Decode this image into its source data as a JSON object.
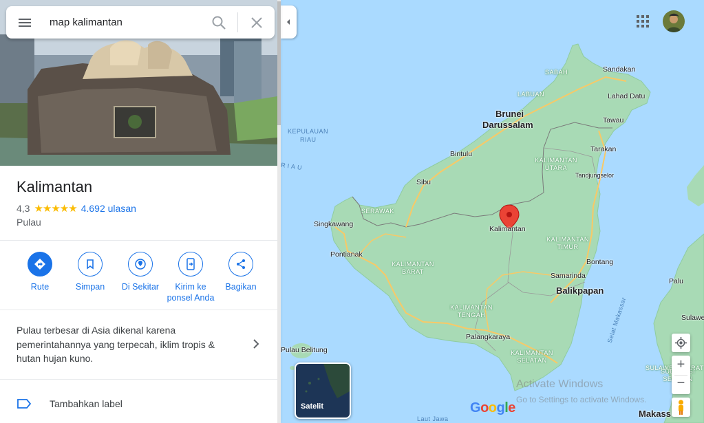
{
  "search": {
    "query": "map kalimantan",
    "menu_icon": "hamburger-menu-icon",
    "search_icon": "magnifier-icon",
    "clear_icon": "close-icon"
  },
  "place": {
    "title": "Kalimantan",
    "rating": "4,3",
    "stars": "★★★★★",
    "reviews": "4.692 ulasan",
    "type": "Pulau",
    "description": "Pulau terbesar di Asia dikenal karena pemerintahannya yang terpecah, iklim tropis & hutan hujan kuno."
  },
  "actions": [
    {
      "label": "Rute",
      "icon": "directions-icon"
    },
    {
      "label": "Simpan",
      "icon": "bookmark-icon"
    },
    {
      "label": "Di Sekitar",
      "icon": "nearby-icon"
    },
    {
      "label": "Kirim ke ponsel Anda",
      "icon": "send-to-phone-icon"
    },
    {
      "label": "Bagikan",
      "icon": "share-icon"
    }
  ],
  "label_row": {
    "text": "Tambahkan label",
    "icon": "label-icon"
  },
  "map": {
    "layer_button": "Satelit",
    "zoom_in": "+",
    "zoom_out": "−",
    "brand": "Google",
    "watermark_line1": "Activate Windows",
    "watermark_line2": "Go to Settings to activate Windows.",
    "pin_label": "Kalimantan",
    "regions": [
      "SABAH",
      "LABUAN",
      "SERAWAK",
      "KALIMANTAN UTARA",
      "KALIMANTAN TIMUR",
      "KALIMANTAN BARAT",
      "KALIMANTAN TENGAH",
      "KALIMANTAN SELATAN",
      "SULAWESI BARAT",
      "SULAWESI SELATAN"
    ],
    "country_label_1": "Brunei",
    "country_label_2": "Darussalam",
    "cities": [
      "Sandakan",
      "Lahad Datu",
      "Tawau",
      "Tarakan",
      "Tandjungselor",
      "Bintulu",
      "Sibu",
      "Singkawang",
      "Pontianak",
      "Bontang",
      "Samarinda",
      "Palangkaraya",
      "Pulau Belitung",
      "Palu",
      "Sulawe"
    ],
    "big_cities": [
      "Balikpapan",
      "Makass"
    ],
    "seas": [
      "KEPULAUAN",
      "RIAU",
      "RIAU",
      "Selat Makassar",
      "Laut Jawa"
    ]
  },
  "colors": {
    "accent": "#1a73e8",
    "land": "#a8dab5",
    "water": "#aadaff",
    "road": "#f8c967",
    "star": "#fbbc04",
    "pin": "#ea4335"
  }
}
